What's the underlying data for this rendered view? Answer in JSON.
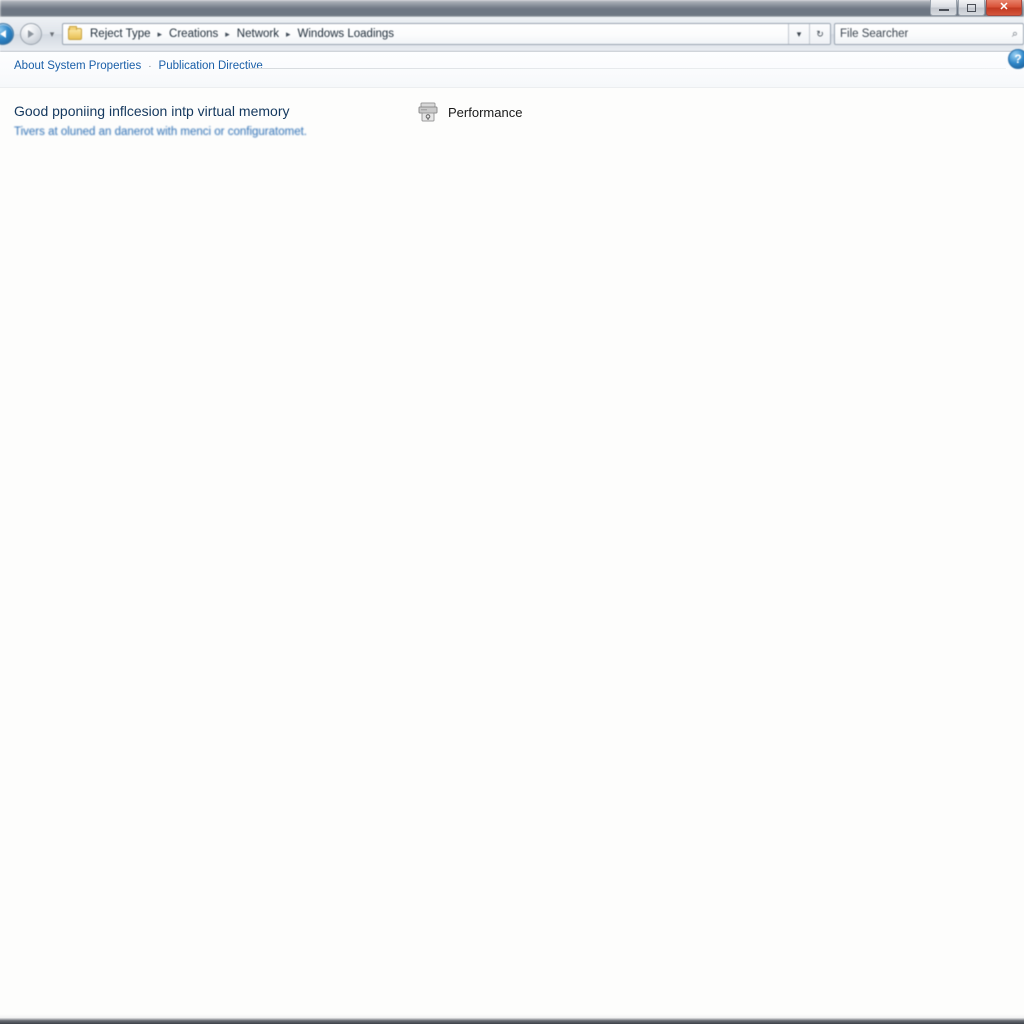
{
  "window": {
    "controls": {
      "minimize_label": "Minimize",
      "maximize_label": "Maximize",
      "close_label": "✕"
    }
  },
  "navbar": {
    "back_label": "Back",
    "forward_label": "Forward",
    "recent_label": "▾",
    "folder_icon": "folder-icon",
    "breadcrumbs": [
      {
        "label": "Reject Type"
      },
      {
        "label": "Creations"
      },
      {
        "label": "Network"
      },
      {
        "label": "Windows Loadings"
      }
    ],
    "separator": "▸",
    "dropdown_glyph": "▾",
    "refresh_glyph": "↻",
    "search": {
      "value": "File Searcher",
      "placeholder": "Search",
      "icon": "⌕"
    }
  },
  "commandbar": {
    "links": [
      {
        "label": "About System Properties"
      },
      {
        "label": "Publication Directive"
      }
    ],
    "separator": "·",
    "help_glyph": "?"
  },
  "content": {
    "heading": "Good pponiing inflcesion intp virtual memory",
    "subtext": "Tivers at oluned an danerot with menci or configuratomet.",
    "items": [
      {
        "label": "Performance",
        "icon": "performance-icon"
      }
    ]
  }
}
